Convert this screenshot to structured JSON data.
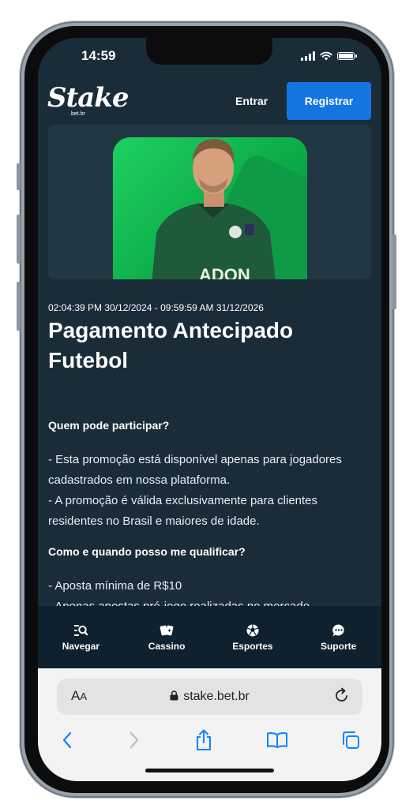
{
  "status_bar": {
    "time": "14:59"
  },
  "header": {
    "logo_text": "Stake",
    "logo_sub": ".bet.br",
    "login_label": "Entrar",
    "register_label": "Registrar"
  },
  "promo": {
    "dates": "02:04:39 PM 30/12/2024 - 09:59:59 AM 31/12/2026",
    "title": "Pagamento Antecipado Futebol",
    "sections": [
      {
        "heading": "Quem pode participar?",
        "lines": [
          "- Esta promoção está disponível apenas para jogadores cadastrados em nossa plataforma.",
          "- A promoção é válida exclusivamente para clientes residentes no Brasil e maiores de idade."
        ]
      },
      {
        "heading": "Como e quando posso me qualificar?",
        "lines": [
          "- Aposta mínima de R$10",
          "- Apenas apostas pré-jogo realizadas no mercado"
        ]
      }
    ]
  },
  "bottom_nav": [
    {
      "label": "Navegar",
      "icon": "browse-icon"
    },
    {
      "label": "Cassino",
      "icon": "cards-icon"
    },
    {
      "label": "Esportes",
      "icon": "ball-icon"
    },
    {
      "label": "Suporte",
      "icon": "chat-icon"
    }
  ],
  "browser": {
    "aa_label_big": "A",
    "aa_label_small": "A",
    "url": "stake.bet.br"
  },
  "colors": {
    "background": "#1a2c38",
    "nav_background": "#0f212e",
    "primary_button": "#1475e1",
    "promo_green": "#0aa746",
    "ios_blue": "#0a84ff"
  }
}
